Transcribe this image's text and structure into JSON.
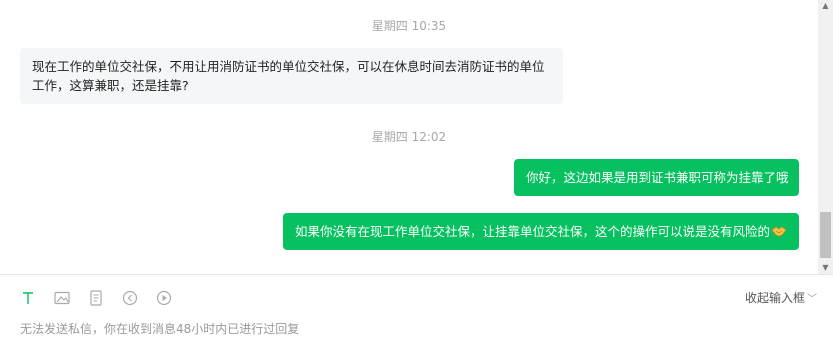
{
  "chat": {
    "timestamp_1": "星期四 10:35",
    "incoming_message_line_1": "现在工作的单位交社保，不用让用消防证书的单位交社保，可以在休息时间去消防证书的单位",
    "incoming_message_line_2": "工作，这算兼职，还是挂靠?",
    "timestamp_2": "星期四 12:02",
    "outgoing_message_1": "你好，这边如果是用到证书兼职可称为挂靠了哦",
    "outgoing_message_2": "如果你没有在现工作单位交社保，让挂靠单位交社保，这个的操作可以说是没有风险的",
    "outgoing_message_2_emoji": "handshake-emoji"
  },
  "composer": {
    "tools": [
      "text-icon",
      "image-icon",
      "document-icon",
      "audio-icon",
      "video-icon"
    ],
    "collapse_label": "收起输入框",
    "notice": "无法发送私信，你在收到消息48小时内已进行过回复"
  },
  "colors": {
    "outgoing_bubble": "#07c160",
    "incoming_bubble": "#f5f6f8",
    "accent_text_tool": "#07c160"
  }
}
